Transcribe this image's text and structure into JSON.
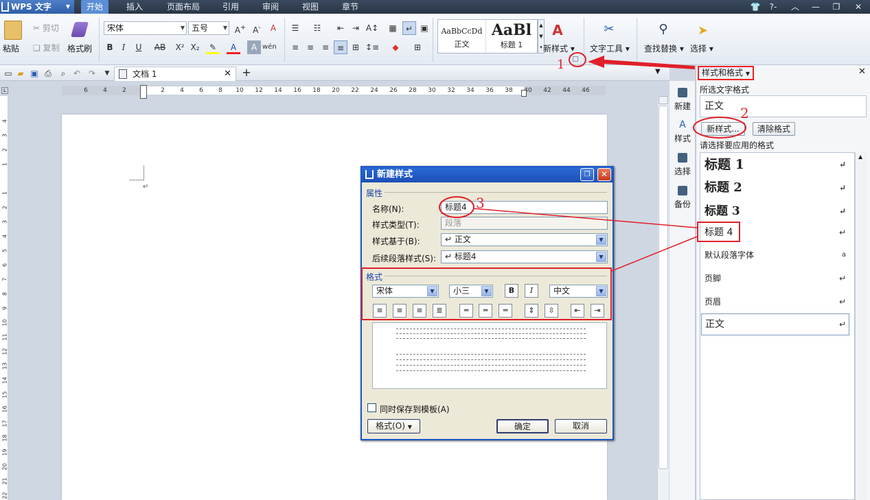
{
  "app": {
    "name": "WPS 文字"
  },
  "menu_tabs": [
    "开始",
    "插入",
    "页面布局",
    "引用",
    "审阅",
    "视图",
    "章节"
  ],
  "ribbon": {
    "paste": "粘贴",
    "cut": "剪切",
    "copy": "复制",
    "format_painter": "格式刷",
    "font_name": "宋体",
    "font_size": "五号",
    "gallery_normal_sample": "AaBbCcDd",
    "gallery_normal": "正文",
    "gallery_h1_sample": "AaBl",
    "gallery_h1": "标题 1",
    "new_style": "新样式",
    "text_tools": "文字工具",
    "find_replace": "查找替换",
    "select": "选择"
  },
  "doc_tab": {
    "title": "文档 1"
  },
  "ruler_ticks": [
    "6",
    "4",
    "2",
    "",
    "2",
    "4",
    "6",
    "8",
    "10",
    "12",
    "14",
    "16",
    "18",
    "20",
    "22",
    "24",
    "26",
    "28",
    "30",
    "32",
    "34",
    "36",
    "38",
    "40",
    "42",
    "44",
    "46"
  ],
  "vruler_ticks": [
    "4",
    "3",
    "2",
    "1",
    "",
    "1",
    "2",
    "3",
    "4",
    "5",
    "6",
    "7",
    "8",
    "9",
    "10",
    "11",
    "12",
    "13",
    "14",
    "15",
    "16",
    "17",
    "18",
    "19",
    "20",
    "21",
    "22"
  ],
  "sidenav": [
    "新建",
    "样式",
    "选择",
    "备份"
  ],
  "task_pane": {
    "title": "样式和格式",
    "selected_label": "所选文字格式",
    "selected_value": "正文",
    "new_style_btn": "新样式...",
    "clear_format_btn": "清除格式",
    "apply_label": "请选择要应用的格式",
    "styles": [
      "标题 1",
      "标题 2",
      "标题 3",
      "标题 4",
      "默认段落字体",
      "页脚",
      "页眉",
      "正文"
    ]
  },
  "dialog": {
    "title": "新建样式",
    "section_props": "属性",
    "name_label": "名称(N):",
    "name_value": "标题4",
    "type_label": "样式类型(T):",
    "type_value": "段落",
    "based_label": "样式基于(B):",
    "based_value": "正文",
    "next_label": "后续段落样式(S):",
    "next_value": "标题4",
    "section_format": "格式",
    "font": "宋体",
    "size": "小三",
    "lang": "中文",
    "bold": "B",
    "italic": "I",
    "save_template": "同时保存到模板(A)",
    "format_btn": "格式(O)",
    "ok": "确定",
    "cancel": "取消"
  },
  "annotations": [
    "1",
    "2",
    "3"
  ],
  "colors": {
    "annotation": "#e0202a",
    "dialog_title": "#1c4fb6",
    "active_tab": "#5a8fd6"
  }
}
